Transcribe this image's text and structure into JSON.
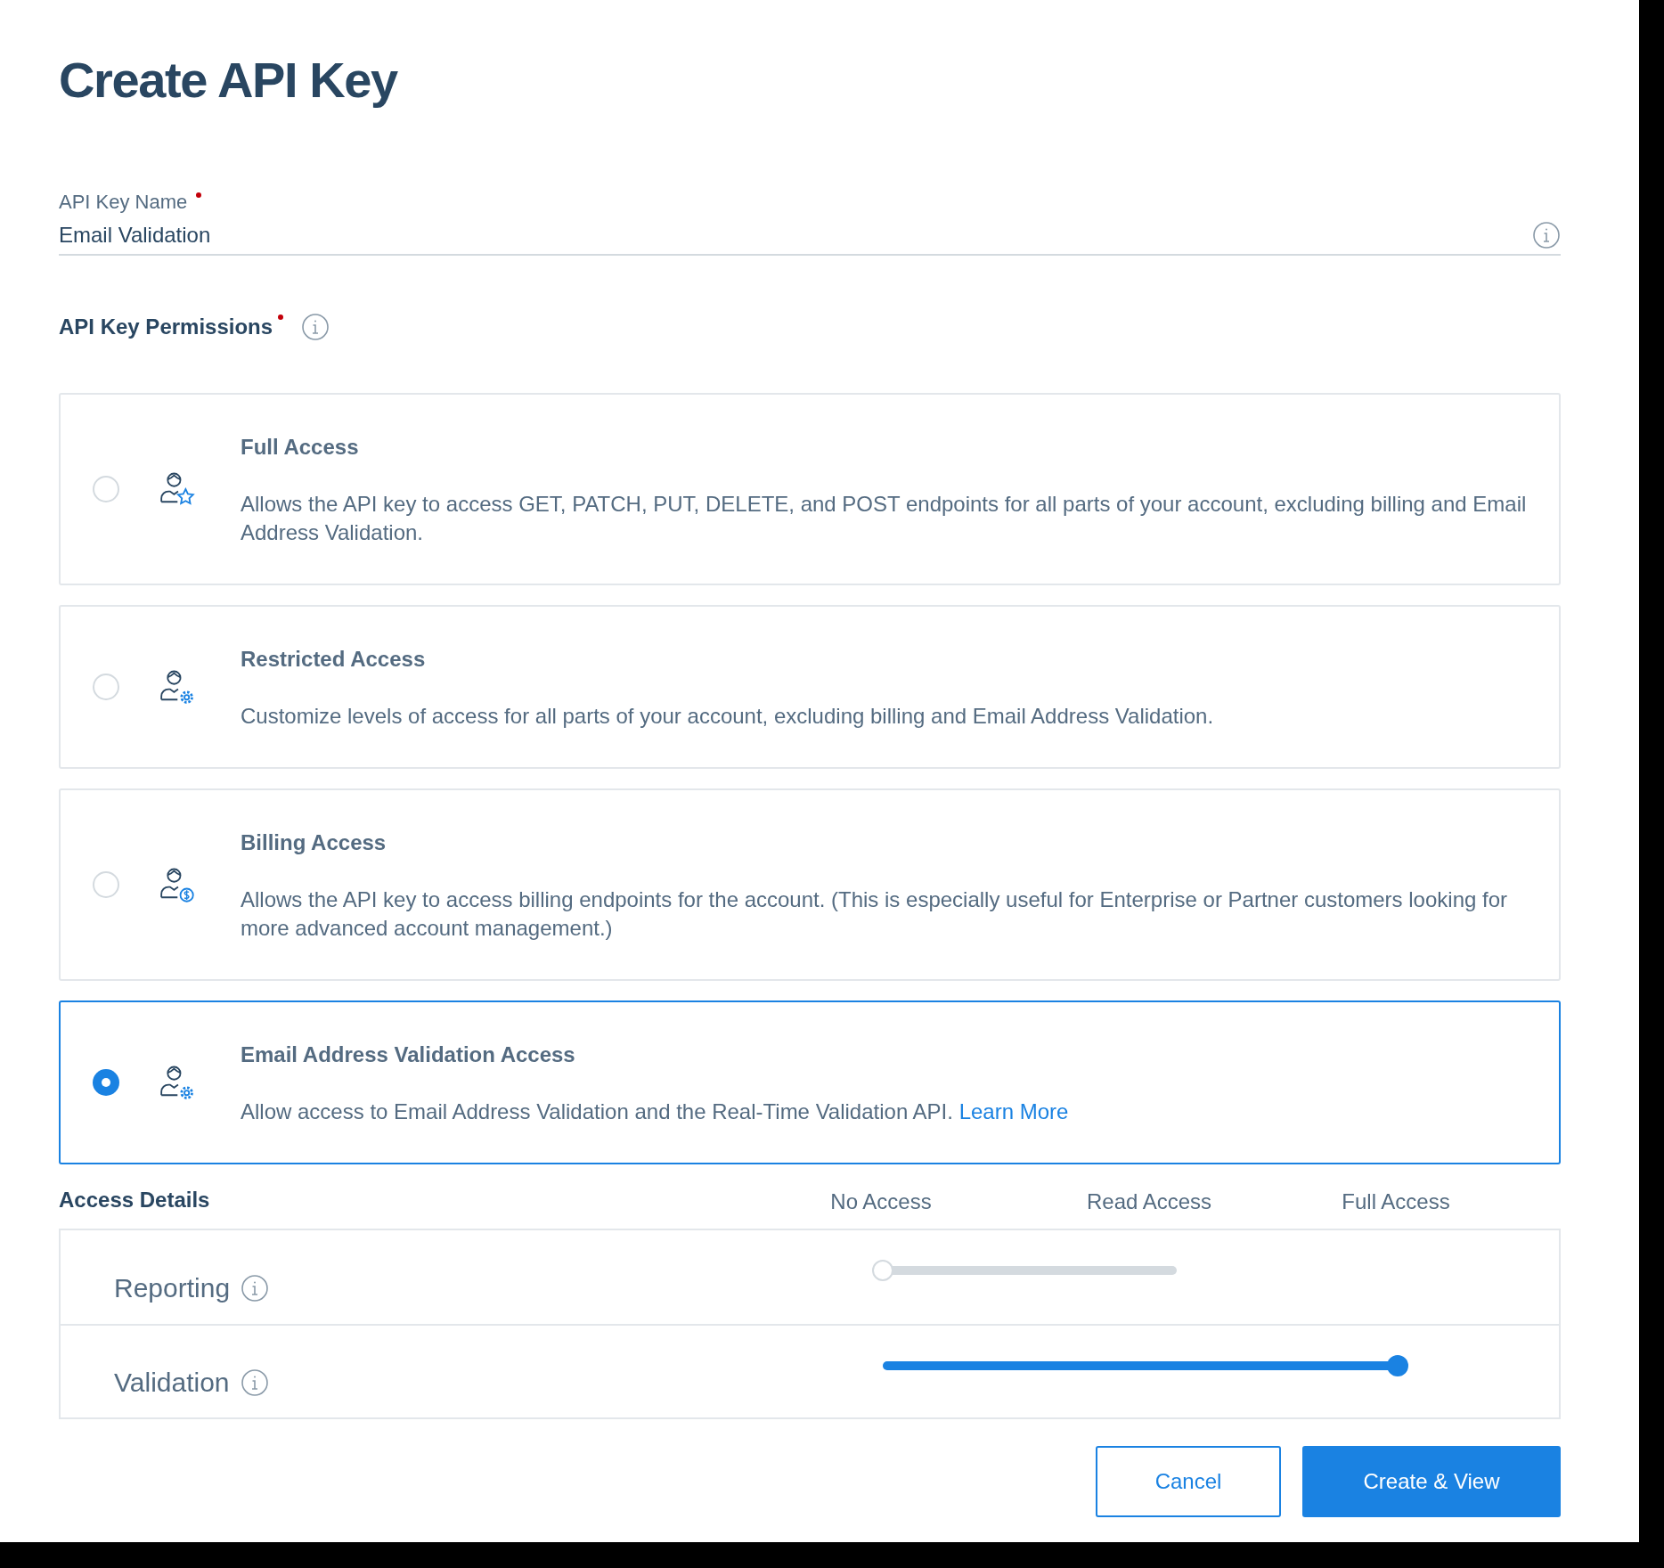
{
  "title": "Create API Key",
  "api_key_name": {
    "label": "API Key Name",
    "required": true,
    "value": "Email Validation"
  },
  "permissions": {
    "label": "API Key Permissions",
    "required": true,
    "options": [
      {
        "title": "Full Access",
        "description": "Allows the API key to access GET, PATCH, PUT, DELETE, and POST endpoints for all parts of your account, excluding billing and Email Address Validation.",
        "kind": "star",
        "selected": false
      },
      {
        "title": "Restricted Access",
        "description": "Customize levels of access for all parts of your account, excluding billing and Email Address Validation.",
        "kind": "gear",
        "selected": false
      },
      {
        "title": "Billing Access",
        "description": "Allows the API key to access billing endpoints for the account. (This is especially useful for Enterprise or Partner customers looking for more advanced account management.)",
        "kind": "dollar",
        "selected": false
      },
      {
        "title": "Email Address Validation Access",
        "description": "Allow access to Email Address Validation and the Real-Time Validation API.",
        "link": "Learn More",
        "kind": "gear",
        "selected": true
      }
    ]
  },
  "access_details": {
    "label": "Access Details",
    "columns": [
      "No Access",
      "Read Access",
      "Full Access"
    ],
    "rows": [
      {
        "label": "Reporting",
        "level": 0,
        "disabled": true
      },
      {
        "label": "Validation",
        "level": 1,
        "disabled": false
      }
    ]
  },
  "buttons": [
    {
      "label": "Cancel",
      "kind": "secondary"
    },
    {
      "label": "Create & View",
      "kind": "primary"
    }
  ]
}
